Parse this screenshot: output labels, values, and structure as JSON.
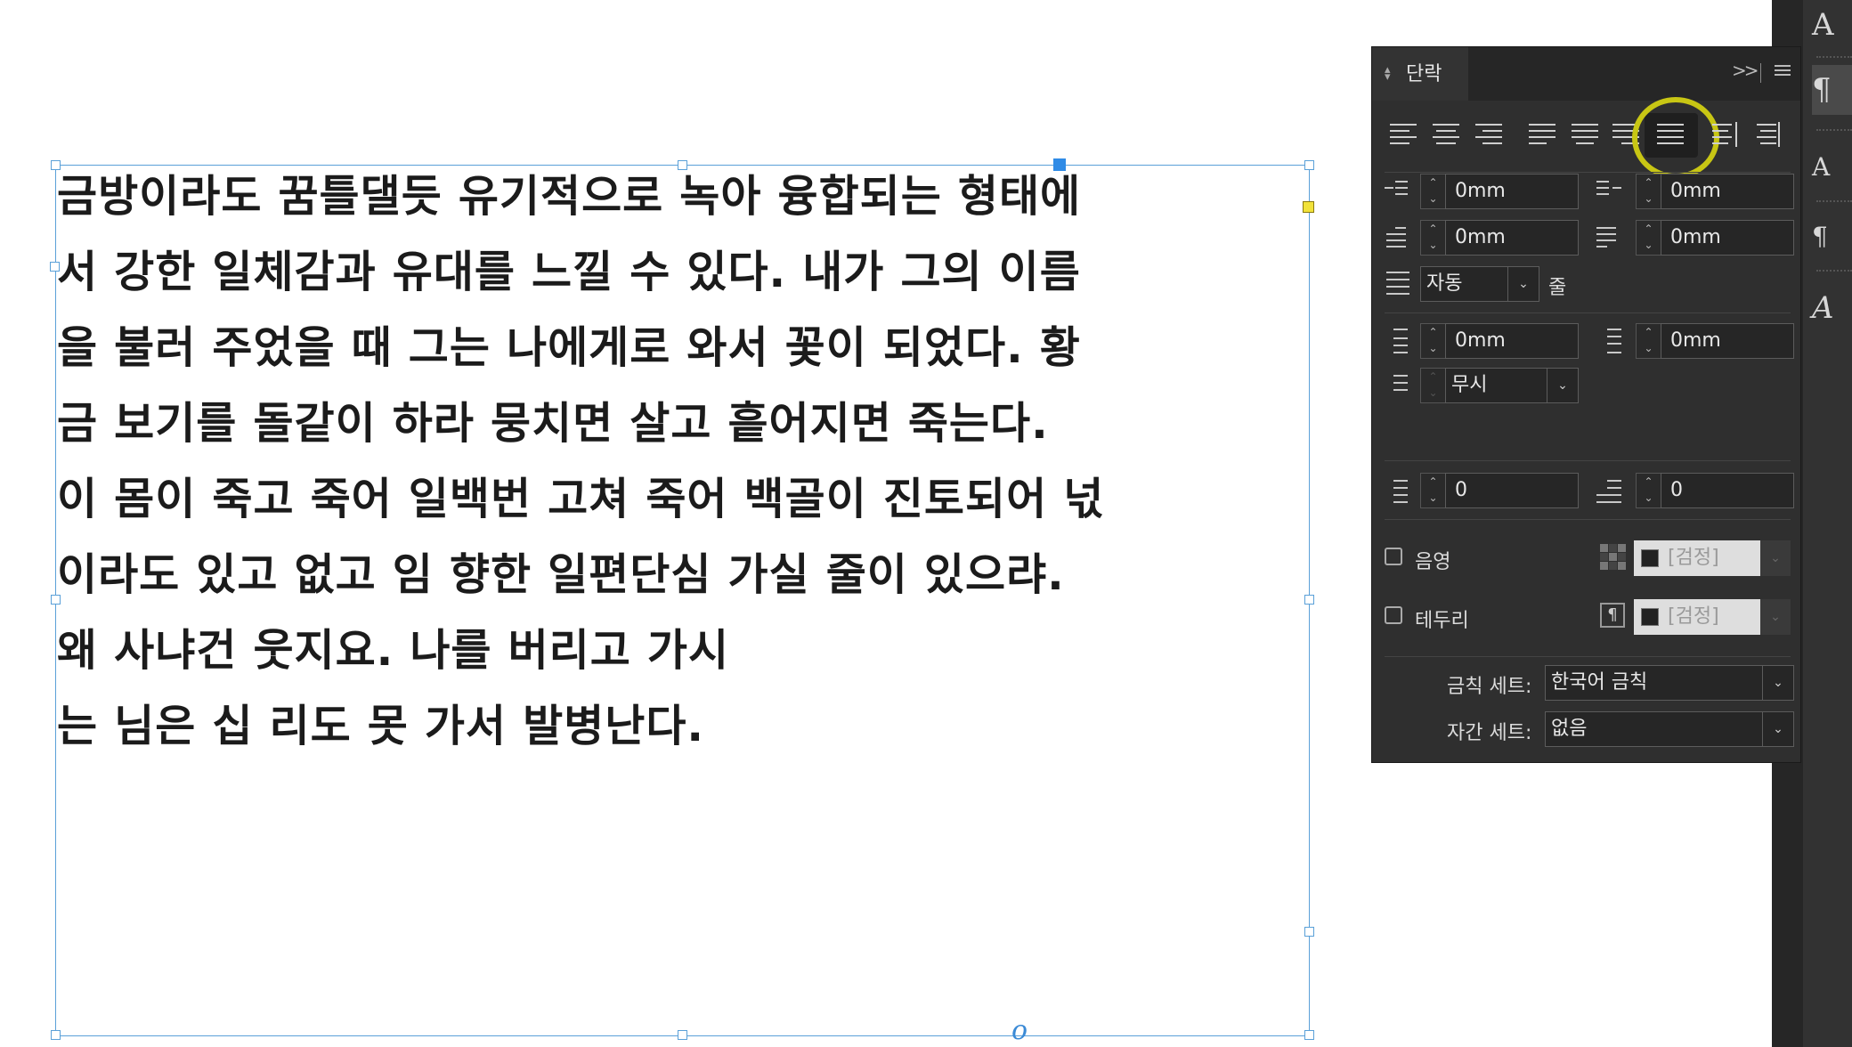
{
  "story": {
    "lines": [
      "금방이라도 꿈틀댈듯 유기적으로 녹아 융합되는 형태에",
      "서 강한 일체감과 유대를 느낄 수 있다.  내가 그의 이름",
      "을 불러 주었을 때 그는 나에게로 와서 꽃이 되었다. 황",
      "금 보기를 돌같이 하라 뭉치면 살고 흩어지면 죽는다.",
      "이 몸이 죽고 죽어 일백번 고쳐 죽어 백골이 진토되어 넋",
      "이라도 있고 없고 임 향한 일편단심 가실 줄이 있으랴.",
      "왜 사냐건 웃지요. 나를 버리고 가시",
      "는 님은 십 리도 못 가서 발병난다."
    ],
    "overset_marker": "o"
  },
  "panel": {
    "title": "단락",
    "collapse_glyph": ">>",
    "alignment_buttons": [
      {
        "icon": "align-left-icon"
      },
      {
        "icon": "align-center-icon"
      },
      {
        "icon": "align-right-icon"
      },
      {
        "icon": "justify-left-icon"
      },
      {
        "icon": "justify-center-icon"
      },
      {
        "icon": "justify-right-icon"
      },
      {
        "icon": "justify-all-icon",
        "selected": true
      },
      {
        "icon": "align-towards-spine-icon"
      },
      {
        "icon": "align-away-from-spine-icon"
      }
    ],
    "left_indent": "0mm",
    "right_indent": "0mm",
    "first_line_indent": "0mm",
    "last_line_indent": "0mm",
    "grid_align": {
      "value": "자동",
      "unit_label": "줄"
    },
    "space_before": "0mm",
    "space_after": "0mm",
    "align_to_grid": "무시",
    "drop_cap_lines": "0",
    "drop_cap_chars": "0",
    "shading": {
      "label": "음영",
      "color": "[검정]",
      "checked": false
    },
    "border": {
      "label": "테두리",
      "color": "[검정]",
      "checked": false
    },
    "kinsoku_set": {
      "label": "금칙 세트:",
      "value": "한국어 금칙"
    },
    "mojikumi_set": {
      "label": "자간 세트:",
      "value": "없음"
    },
    "highlight_color": "#c8c614"
  },
  "toolstrip": {
    "items": [
      {
        "icon": "character-icon",
        "glyph": "A"
      },
      {
        "icon": "paragraph-icon",
        "glyph": "¶",
        "active": true
      },
      {
        "icon": "character-styles-icon",
        "glyph": "A"
      },
      {
        "icon": "paragraph-styles-icon",
        "glyph": "¶"
      },
      {
        "icon": "glyphs-icon",
        "glyph": "A"
      }
    ]
  }
}
